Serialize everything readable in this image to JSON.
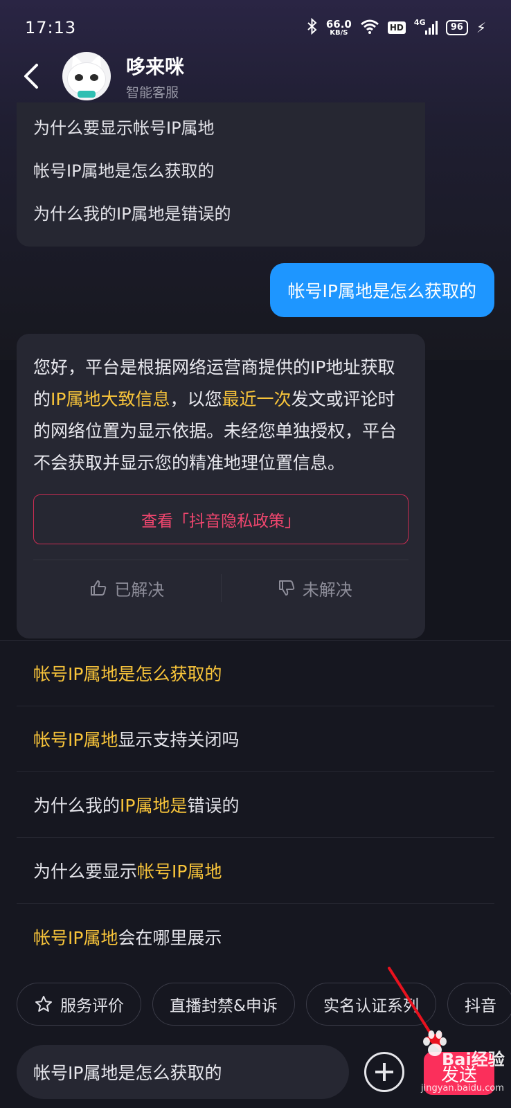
{
  "status_bar": {
    "time": "17:13",
    "net_speed_value": "66.0",
    "net_speed_unit": "KB/S",
    "hd": "HD",
    "network": "4G",
    "battery": "96",
    "icons": [
      "bluetooth-icon",
      "wifi-icon",
      "signal-icon",
      "battery-icon",
      "charging-icon"
    ]
  },
  "header": {
    "title": "哆来咪",
    "subtitle": "智能客服"
  },
  "chat": {
    "faq_items": [
      "为什么要显示帐号IP属地",
      "帐号IP属地是怎么获取的",
      "为什么我的IP属地是错误的"
    ],
    "user_message": "帐号IP属地是怎么获取的",
    "answer": {
      "p1": "您好，平台是根据网络运营商提供的IP地址获取的",
      "h1": "IP属地大致信息",
      "p2": "，以您",
      "h2": "最近一次",
      "p3": "发文或评论时的网络位置为显示依据。未经您单独授权，平台不会获取并显示您的精准地理位置信息。"
    },
    "policy_button": "查看「抖音隐私政策」",
    "resolved": "已解决",
    "unresolved": "未解决"
  },
  "suggestions": [
    {
      "parts": [
        {
          "t": "帐号IP属地是怎么获取的",
          "hl": true
        }
      ]
    },
    {
      "parts": [
        {
          "t": "帐号IP属地",
          "hl": true
        },
        {
          "t": "显示支持关闭吗",
          "hl": false
        }
      ]
    },
    {
      "parts": [
        {
          "t": "为什么我的",
          "hl": false
        },
        {
          "t": "IP属地是",
          "hl": true
        },
        {
          "t": "错误的",
          "hl": false
        }
      ]
    },
    {
      "parts": [
        {
          "t": "为什么要显示",
          "hl": false
        },
        {
          "t": "帐号IP属地",
          "hl": true
        }
      ]
    },
    {
      "parts": [
        {
          "t": "帐号IP属地",
          "hl": true
        },
        {
          "t": "会在哪里展示",
          "hl": false
        }
      ]
    }
  ],
  "quick_chips": [
    "服务评价",
    "直播封禁&申诉",
    "实名认证系列",
    "抖音"
  ],
  "input": {
    "value": "帐号IP属地是怎么获取的",
    "send_label": "发送"
  },
  "watermark": {
    "brand": "Bai",
    "brand_suffix": "经验",
    "url": "jingyan.baidu.com"
  },
  "colors": {
    "accent_blue": "#1e96ff",
    "highlight_yellow": "#f8c43a",
    "send_pink": "#fb2f5b",
    "annotation_red": "#e8121e"
  }
}
